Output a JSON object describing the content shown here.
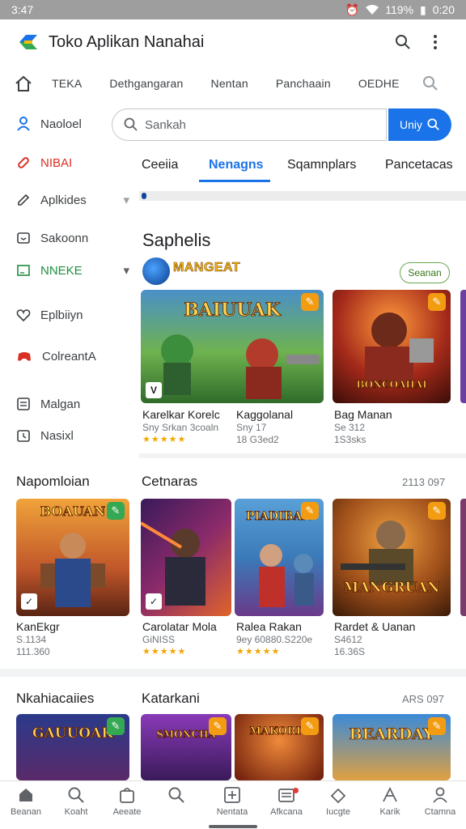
{
  "status": {
    "time": "3:47",
    "battery": "119%",
    "clock_right": "0:20"
  },
  "app": {
    "title": "Toko Aplikan Nanahai"
  },
  "top_tabs": [
    "TEKA",
    "Dethgangaran",
    "Nentan",
    "Panchaain",
    "OEDHE"
  ],
  "sidebar": [
    {
      "label": "Naoloel",
      "icon": "person-icon",
      "color": "#1a73e8"
    },
    {
      "label": "NIBAI",
      "icon": "pill-icon",
      "color": "#d93025"
    },
    {
      "label": "Aplkides",
      "icon": "edit-icon",
      "color": "#3c4043"
    },
    {
      "label": "Sakoonn",
      "icon": "box-icon",
      "color": "#3c4043"
    },
    {
      "label": "NNEKE",
      "icon": "square-icon",
      "color": "#1e8e3e"
    },
    {
      "label": "Eplbiiyn",
      "icon": "heart-icon",
      "color": "#3c4043"
    },
    {
      "label": "ColreantA",
      "icon": "controller-icon",
      "color": "#d93025"
    },
    {
      "label": "Malgan",
      "icon": "list-icon",
      "color": "#3c4043"
    },
    {
      "label": "Nasixl",
      "icon": "clock-icon",
      "color": "#3c4043"
    }
  ],
  "search": {
    "placeholder": "Sankah",
    "button_label": "Uniy"
  },
  "sub_tabs": [
    "Ceeiia",
    "Nenagns",
    "Sqamnplars",
    "Pancetacas"
  ],
  "featured": {
    "section_title": "Saphelis",
    "promo_text": "MANGEAT",
    "promo_button": "Seanan",
    "cards": [
      {
        "name": "Karelkar Korelc",
        "meta1": "Sny Srkan 3coaln",
        "meta2": "",
        "stars": "★★★★★",
        "art_title": "BAIUUAK",
        "badge_color": "#f39c12"
      },
      {
        "name": "Kaggolanal",
        "meta1": "Sny 17",
        "meta2": "18 G3ed2",
        "stars": "",
        "art_title": "BONCOAHAI",
        "badge_color": "#f39c12"
      },
      {
        "name": "Bag Manan",
        "meta1": "Se 312",
        "meta2": "1S3sks",
        "stars": "",
        "art_title": "",
        "badge_color": "#f39c12"
      }
    ]
  },
  "row2": {
    "left_title": "Napomloian",
    "title": "Cetnaras",
    "meta": "2113 097",
    "cards": [
      {
        "name": "KanEkgr",
        "meta1": "S.1134",
        "meta2": "111.360",
        "stars": "",
        "art_title": "BOAUAN",
        "badge_color": "#34a853"
      },
      {
        "name": "Carolatar Mola",
        "meta1": "GiNISS",
        "meta2": "",
        "stars": "★★★★★",
        "art_title": "",
        "badge_color": ""
      },
      {
        "name": "Ralea Rakan",
        "meta1": "9ey 60880.S220e",
        "meta2": "",
        "stars": "★★★★★",
        "art_title": "PIADIBAN",
        "badge_color": "#f39c12"
      },
      {
        "name": "Rardet & Uanan",
        "meta1": "S4612",
        "meta2": "16.36S",
        "stars": "",
        "art_title": "MANGRUAN",
        "badge_color": "#f39c12"
      }
    ]
  },
  "row3": {
    "left_title": "Nkahiacaiies",
    "title": "Katarkani",
    "meta": "ARS 097",
    "cards": [
      {
        "art_title": "GAUUOAK",
        "badge_color": "#34a853"
      },
      {
        "art_title": "SMONCHA",
        "badge_color": "#f39c12"
      },
      {
        "art_title": "MAKORIT",
        "badge_color": "#f39c12"
      },
      {
        "art_title": "BEARDAY",
        "badge_color": "#f39c12"
      }
    ]
  },
  "bottom_nav": [
    "Beanan",
    "Koaht",
    "Aeeate",
    "",
    "Nentata",
    "Afkcana",
    "Iucgte",
    "Karik",
    "Ctamna"
  ]
}
